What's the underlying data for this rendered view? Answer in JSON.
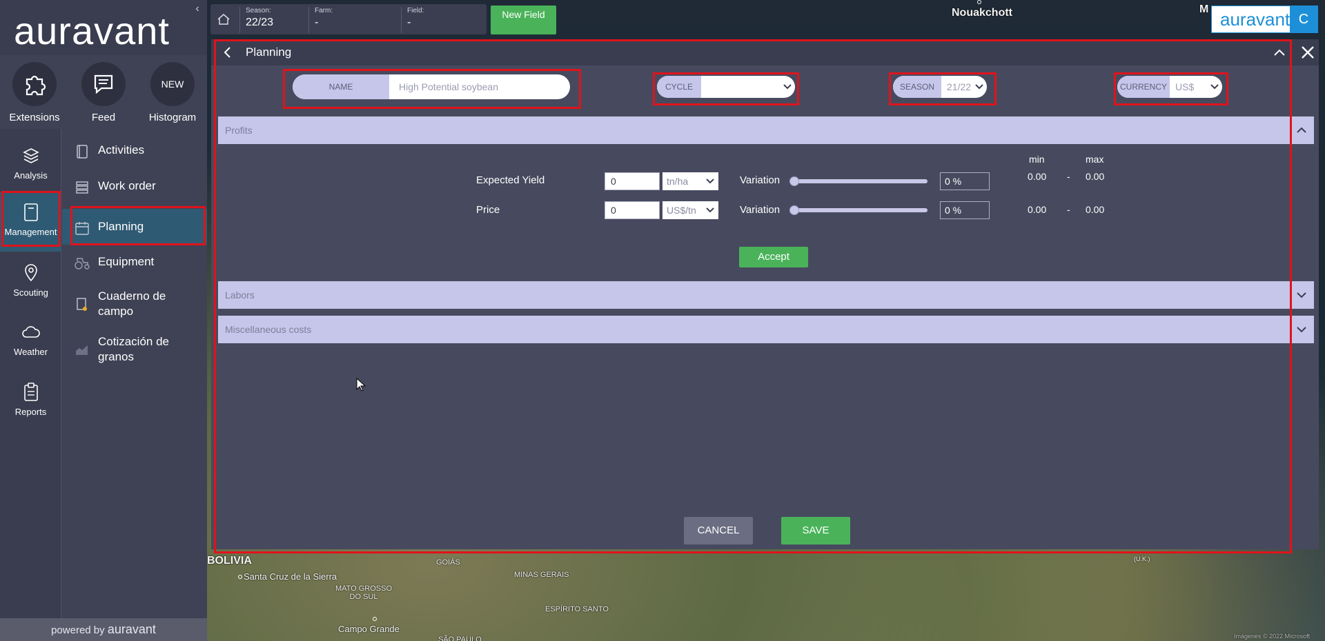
{
  "brand": {
    "logo_text": "auravant",
    "corner_logo_text": "auravant",
    "corner_badge": "C",
    "powered_prefix": "powered by",
    "powered_brand": "auravant"
  },
  "quick_actions": [
    {
      "label": "Extensions",
      "icon": "puzzle-icon"
    },
    {
      "label": "Feed",
      "icon": "chat-icon"
    },
    {
      "label": "Histogram",
      "icon": "new-badge",
      "badge": "NEW"
    }
  ],
  "side_icons": [
    {
      "label": "Analysis",
      "icon": "layers-icon"
    },
    {
      "label": "Management",
      "icon": "notebook-icon",
      "active": true
    },
    {
      "label": "Scouting",
      "icon": "map-pin-icon"
    },
    {
      "label": "Weather",
      "icon": "cloud-icon"
    },
    {
      "label": "Reports",
      "icon": "clipboard-icon"
    }
  ],
  "side_menu": [
    {
      "label": "Activities",
      "icon": "notebook-icon"
    },
    {
      "label": "Work order",
      "icon": "list-icon"
    },
    {
      "label": "Planning",
      "icon": "calendar-icon",
      "active": true
    },
    {
      "label": "Equipment",
      "icon": "tractor-icon"
    },
    {
      "label": "Cuaderno de campo",
      "icon": "field-book-icon"
    },
    {
      "label": "Cotización de granos",
      "icon": "chart-icon"
    }
  ],
  "topbar": {
    "season_caption": "Season:",
    "season_value": "22/23",
    "farm_caption": "Farm:",
    "farm_value": "-",
    "field_caption": "Field:",
    "field_value": "-",
    "new_field_label": "New Field"
  },
  "map_labels": {
    "nouakchott": "Nouakchott",
    "m_label": "M",
    "bolivia": "BOLIVIA",
    "santa_cruz": "Santa Cruz de la Sierra",
    "mato_grosso": "MATO GROSSO DO SUL",
    "goias": "GOIÁS",
    "minas": "MINAS GERAIS",
    "espirito": "ESPÍRITO SANTO",
    "campo_grande": "Campo Grande",
    "sao_paulo": "SÃO PAULO",
    "uk_label": "(U.K.)",
    "copyright": "Imágenes © 2022 Microsoft"
  },
  "panel": {
    "title": "Planning",
    "name_label": "NAME",
    "name_value": "High Potential soybean",
    "cycle_label": "CYCLE",
    "cycle_value": "",
    "season_label": "SEASON",
    "season_value": "21/22",
    "currency_label": "CURRENCY",
    "currency_value": "US$",
    "sections": {
      "profits": "Profits",
      "labors": "Labors",
      "misc": "Miscellaneous costs"
    },
    "min_header": "min",
    "max_header": "max",
    "rows": [
      {
        "label": "Expected Yield",
        "value": "0",
        "unit": "tn/ha",
        "variation_label": "Variation",
        "variation": "0 %",
        "slider_level": 0,
        "min": "0.00",
        "sep": "-",
        "max": "0.00"
      },
      {
        "label": "Price",
        "value": "0",
        "unit": "US$/tn",
        "variation_label": "Variation",
        "variation": "0 %",
        "slider_level": 0,
        "min": "0.00",
        "sep": "-",
        "max": "0.00"
      }
    ],
    "accept_label": "Accept",
    "cancel_label": "CANCEL",
    "save_label": "SAVE"
  },
  "colors": {
    "accent_green": "#4ab35a",
    "highlight_red": "#e0131b",
    "section_lavender": "#c6c5ea",
    "brand_blue": "#1d8fd8"
  }
}
